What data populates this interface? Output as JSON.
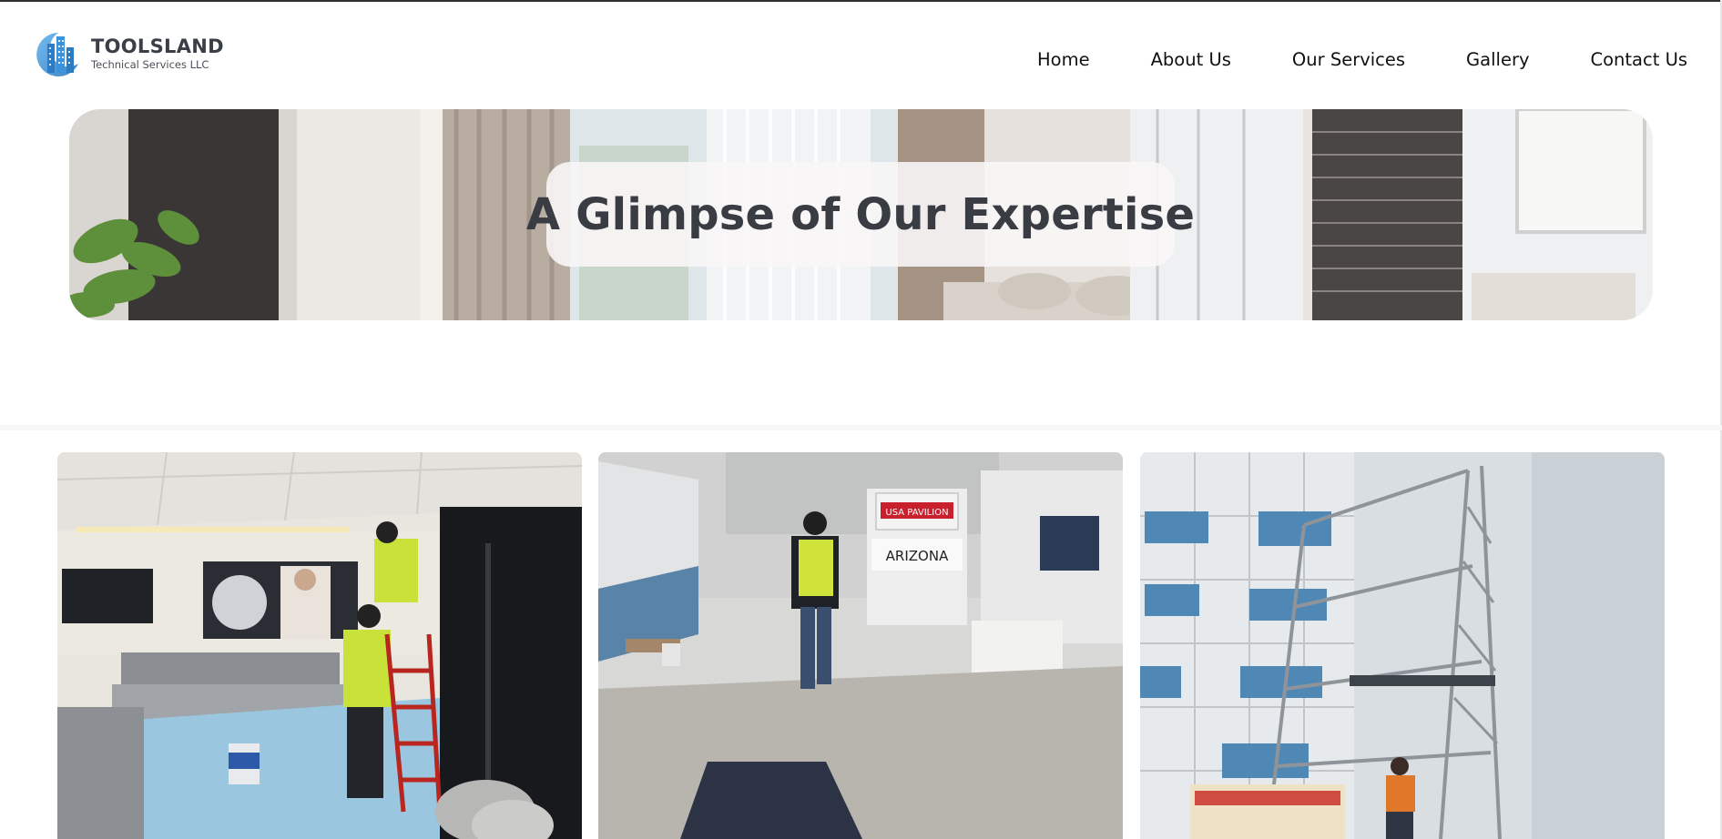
{
  "brand": {
    "name": "TOOLSLAND",
    "tagline": "Technical Services LLC",
    "logo_icon": "building-logo-icon",
    "accent": "#3a8fd6"
  },
  "nav": {
    "items": [
      {
        "label": "Home"
      },
      {
        "label": "About Us"
      },
      {
        "label": "Our Services"
      },
      {
        "label": "Gallery"
      },
      {
        "label": "Contact Us"
      }
    ]
  },
  "banner": {
    "title": "A Glimpse of Our Expertise"
  },
  "gallery": {
    "photos": [
      {
        "subject": "workers installing fit-out in lounge"
      },
      {
        "subject": "worker walking through exhibition hall",
        "signs": [
          "USA PAVILION",
          "ARIZONA"
        ]
      },
      {
        "subject": "scaffolding against white building facade"
      }
    ]
  }
}
